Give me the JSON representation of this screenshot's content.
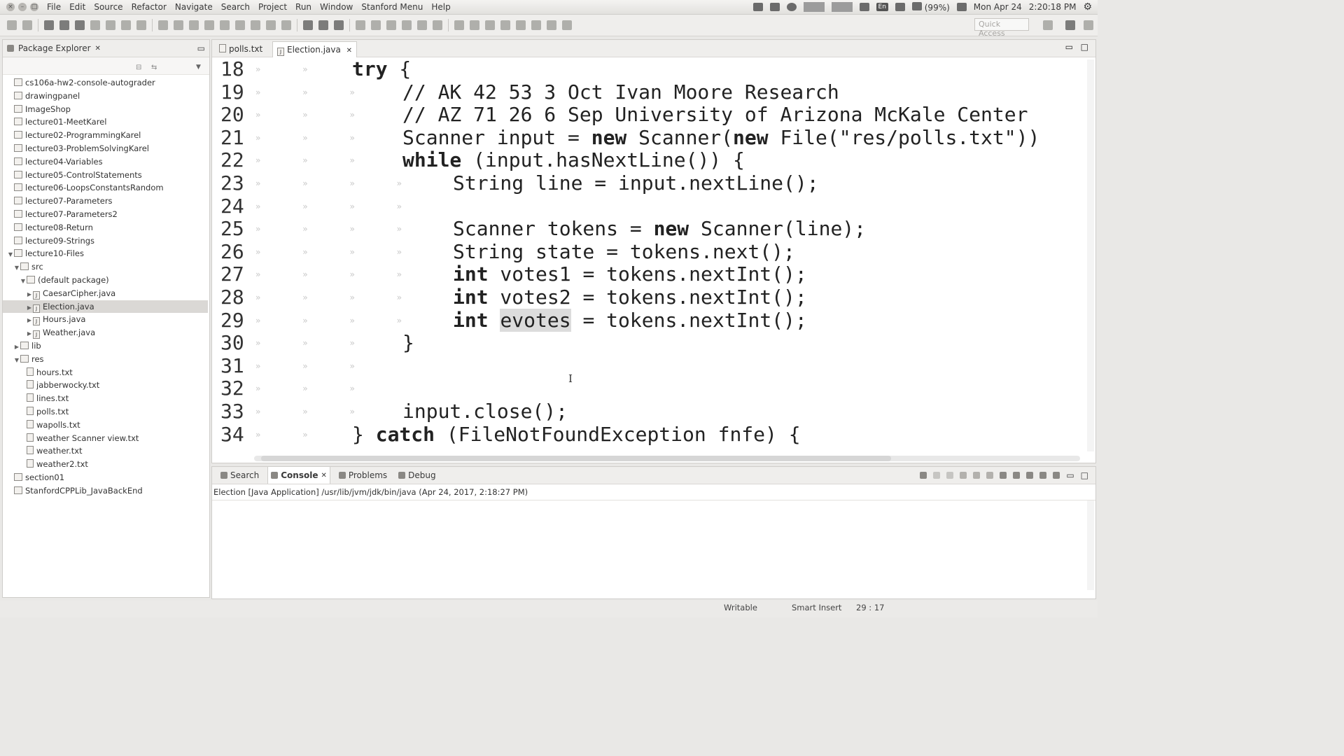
{
  "menubar": {
    "items": [
      "File",
      "Edit",
      "Source",
      "Refactor",
      "Navigate",
      "Search",
      "Project",
      "Run",
      "Window",
      "Stanford Menu",
      "Help"
    ],
    "battery": "(99%)",
    "datetime": "Mon Apr 24",
    "clock": "2:20:18 PM",
    "lang": "En"
  },
  "toolbar": {
    "quick_access_placeholder": "Quick Access"
  },
  "package_explorer": {
    "title": "Package Explorer",
    "items": [
      {
        "label": "cs106a-hw2-console-autograder",
        "depth": 0,
        "type": "project",
        "twisty": ""
      },
      {
        "label": "drawingpanel",
        "depth": 0,
        "type": "project",
        "twisty": ""
      },
      {
        "label": "ImageShop",
        "depth": 0,
        "type": "project",
        "twisty": ""
      },
      {
        "label": "lecture01-MeetKarel",
        "depth": 0,
        "type": "project",
        "twisty": ""
      },
      {
        "label": "lecture02-ProgrammingKarel",
        "depth": 0,
        "type": "project",
        "twisty": ""
      },
      {
        "label": "lecture03-ProblemSolvingKarel",
        "depth": 0,
        "type": "project",
        "twisty": ""
      },
      {
        "label": "lecture04-Variables",
        "depth": 0,
        "type": "project",
        "twisty": ""
      },
      {
        "label": "lecture05-ControlStatements",
        "depth": 0,
        "type": "project",
        "twisty": ""
      },
      {
        "label": "lecture06-LoopsConstantsRandom",
        "depth": 0,
        "type": "project",
        "twisty": ""
      },
      {
        "label": "lecture07-Parameters",
        "depth": 0,
        "type": "project",
        "twisty": ""
      },
      {
        "label": "lecture07-Parameters2",
        "depth": 0,
        "type": "project",
        "twisty": ""
      },
      {
        "label": "lecture08-Return",
        "depth": 0,
        "type": "project",
        "twisty": ""
      },
      {
        "label": "lecture09-Strings",
        "depth": 0,
        "type": "project",
        "twisty": ""
      },
      {
        "label": "lecture10-Files",
        "depth": 0,
        "type": "project",
        "twisty": "▼"
      },
      {
        "label": "src",
        "depth": 1,
        "type": "folder",
        "twisty": "▼"
      },
      {
        "label": "(default package)",
        "depth": 2,
        "type": "package",
        "twisty": "▼"
      },
      {
        "label": "CaesarCipher.java",
        "depth": 3,
        "type": "java",
        "twisty": "▶"
      },
      {
        "label": "Election.java",
        "depth": 3,
        "type": "java",
        "twisty": "▶",
        "selected": true
      },
      {
        "label": "Hours.java",
        "depth": 3,
        "type": "java",
        "twisty": "▶"
      },
      {
        "label": "Weather.java",
        "depth": 3,
        "type": "java",
        "twisty": "▶"
      },
      {
        "label": "lib",
        "depth": 1,
        "type": "folder",
        "twisty": "▶"
      },
      {
        "label": "res",
        "depth": 1,
        "type": "folder",
        "twisty": "▼"
      },
      {
        "label": "hours.txt",
        "depth": 2,
        "type": "txt",
        "twisty": ""
      },
      {
        "label": "jabberwocky.txt",
        "depth": 2,
        "type": "txt",
        "twisty": ""
      },
      {
        "label": "lines.txt",
        "depth": 2,
        "type": "txt",
        "twisty": ""
      },
      {
        "label": "polls.txt",
        "depth": 2,
        "type": "txt",
        "twisty": ""
      },
      {
        "label": "wapolls.txt",
        "depth": 2,
        "type": "txt",
        "twisty": ""
      },
      {
        "label": "weather Scanner view.txt",
        "depth": 2,
        "type": "txt",
        "twisty": ""
      },
      {
        "label": "weather.txt",
        "depth": 2,
        "type": "txt",
        "twisty": ""
      },
      {
        "label": "weather2.txt",
        "depth": 2,
        "type": "txt",
        "twisty": ""
      },
      {
        "label": "section01",
        "depth": 0,
        "type": "project",
        "twisty": ""
      },
      {
        "label": "StanfordCPPLib_JavaBackEnd",
        "depth": 0,
        "type": "project",
        "twisty": ""
      }
    ]
  },
  "editor": {
    "tabs": [
      "polls.txt",
      "Election.java"
    ],
    "active_tab": "Election.java",
    "lines": [
      {
        "num": "18",
        "indent": 0,
        "tokens": [
          {
            "t": "try",
            "kw": true
          },
          {
            "t": " {"
          }
        ]
      },
      {
        "num": "19",
        "indent": 1,
        "tokens": [
          {
            "t": "// AK 42 53 3 Oct Ivan Moore Research"
          }
        ]
      },
      {
        "num": "20",
        "indent": 1,
        "tokens": [
          {
            "t": "// AZ 71 26 6 Sep University of Arizona McKale Center"
          }
        ]
      },
      {
        "num": "21",
        "indent": 1,
        "tokens": [
          {
            "t": "Scanner input = "
          },
          {
            "t": "new",
            "kw": true
          },
          {
            "t": " Scanner("
          },
          {
            "t": "new",
            "kw": true
          },
          {
            "t": " File(\"res/polls.txt\"))"
          }
        ]
      },
      {
        "num": "22",
        "indent": 1,
        "tokens": [
          {
            "t": "while",
            "kw": true
          },
          {
            "t": " (input.hasNextLine()) {"
          }
        ]
      },
      {
        "num": "23",
        "indent": 2,
        "tokens": [
          {
            "t": "String line = input.nextLine();"
          }
        ]
      },
      {
        "num": "24",
        "indent": 2,
        "tokens": []
      },
      {
        "num": "25",
        "indent": 2,
        "tokens": [
          {
            "t": "Scanner tokens = "
          },
          {
            "t": "new",
            "kw": true
          },
          {
            "t": " Scanner(line);"
          }
        ]
      },
      {
        "num": "26",
        "indent": 2,
        "tokens": [
          {
            "t": "String state = tokens.next();"
          }
        ]
      },
      {
        "num": "27",
        "indent": 2,
        "tokens": [
          {
            "t": "int",
            "kw": true
          },
          {
            "t": " votes1 = tokens.nextInt();"
          }
        ]
      },
      {
        "num": "28",
        "indent": 2,
        "tokens": [
          {
            "t": "int",
            "kw": true
          },
          {
            "t": " votes2 = tokens.nextInt();"
          }
        ]
      },
      {
        "num": "29",
        "indent": 2,
        "tokens": [
          {
            "t": "int",
            "kw": true
          },
          {
            "t": " "
          },
          {
            "t": "evotes",
            "hl": true
          },
          {
            "t": " = tokens.nextInt();"
          }
        ]
      },
      {
        "num": "30",
        "indent": 1,
        "tokens": [
          {
            "t": "}"
          }
        ]
      },
      {
        "num": "31",
        "indent": 1,
        "tokens": []
      },
      {
        "num": "32",
        "indent": 1,
        "tokens": []
      },
      {
        "num": "33",
        "indent": 1,
        "tokens": [
          {
            "t": "input.close();"
          }
        ]
      },
      {
        "num": "34",
        "indent": 0,
        "tokens": [
          {
            "t": "} "
          },
          {
            "t": "catch",
            "kw": true
          },
          {
            "t": " (FileNotFoundException fnfe) {"
          }
        ]
      }
    ]
  },
  "console": {
    "tabs": [
      "Search",
      "Console",
      "Problems",
      "Debug"
    ],
    "active_tab": "Console",
    "description": "Election [Java Application] /usr/lib/jvm/jdk/bin/java (Apr 24, 2017, 2:18:27 PM)"
  },
  "status": {
    "writable": "Writable",
    "insert_mode": "Smart Insert",
    "position": "29 : 17"
  }
}
